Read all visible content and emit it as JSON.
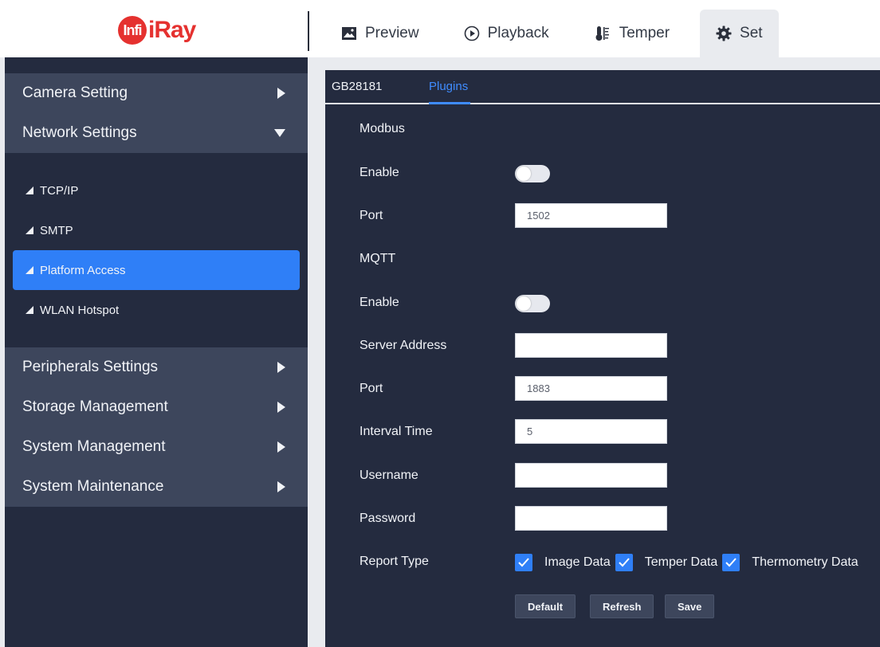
{
  "logo": {
    "badge": "Infi",
    "text": "iRay"
  },
  "nav": {
    "items": [
      {
        "label": "Preview",
        "icon": "image-icon"
      },
      {
        "label": "Playback",
        "icon": "play-circle-icon"
      },
      {
        "label": "Temper",
        "icon": "thermometer-icon"
      },
      {
        "label": "Set",
        "icon": "gear-icon"
      }
    ],
    "active": "Set"
  },
  "sidebar": {
    "groups": [
      {
        "label": "Camera Setting"
      },
      {
        "label": "Network Settings"
      },
      {
        "label": "Peripherals Settings"
      },
      {
        "label": "Storage Management"
      },
      {
        "label": "System Management"
      },
      {
        "label": "System Maintenance"
      }
    ],
    "network_items": [
      {
        "label": "TCP/IP"
      },
      {
        "label": "SMTP"
      },
      {
        "label": "Platform Access"
      },
      {
        "label": "WLAN Hotspot"
      }
    ],
    "active_item": "Platform Access"
  },
  "tabs": [
    {
      "label": "GB28181"
    },
    {
      "label": "Plugins"
    }
  ],
  "active_tab": "Plugins",
  "form": {
    "modbus": {
      "title": "Modbus",
      "enable_label": "Enable",
      "enabled": false,
      "port_label": "Port",
      "port": "1502"
    },
    "mqtt": {
      "title": "MQTT",
      "enable_label": "Enable",
      "enabled": false,
      "server_label": "Server Address",
      "server": "",
      "port_label": "Port",
      "port": "1883",
      "interval_label": "Interval Time",
      "interval": "5",
      "username_label": "Username",
      "username": "",
      "password_label": "Password",
      "password": ""
    },
    "report": {
      "label": "Report Type",
      "options": [
        {
          "label": "Image Data",
          "checked": true
        },
        {
          "label": "Temper Data",
          "checked": true
        },
        {
          "label": "Thermometry Data",
          "checked": true
        }
      ]
    },
    "buttons": {
      "default": "Default",
      "refresh": "Refresh",
      "save": "Save"
    }
  },
  "colors": {
    "accent": "#2f7ff7",
    "panel": "#242b3f",
    "group": "#3d465c",
    "brand": "#e5312f"
  }
}
